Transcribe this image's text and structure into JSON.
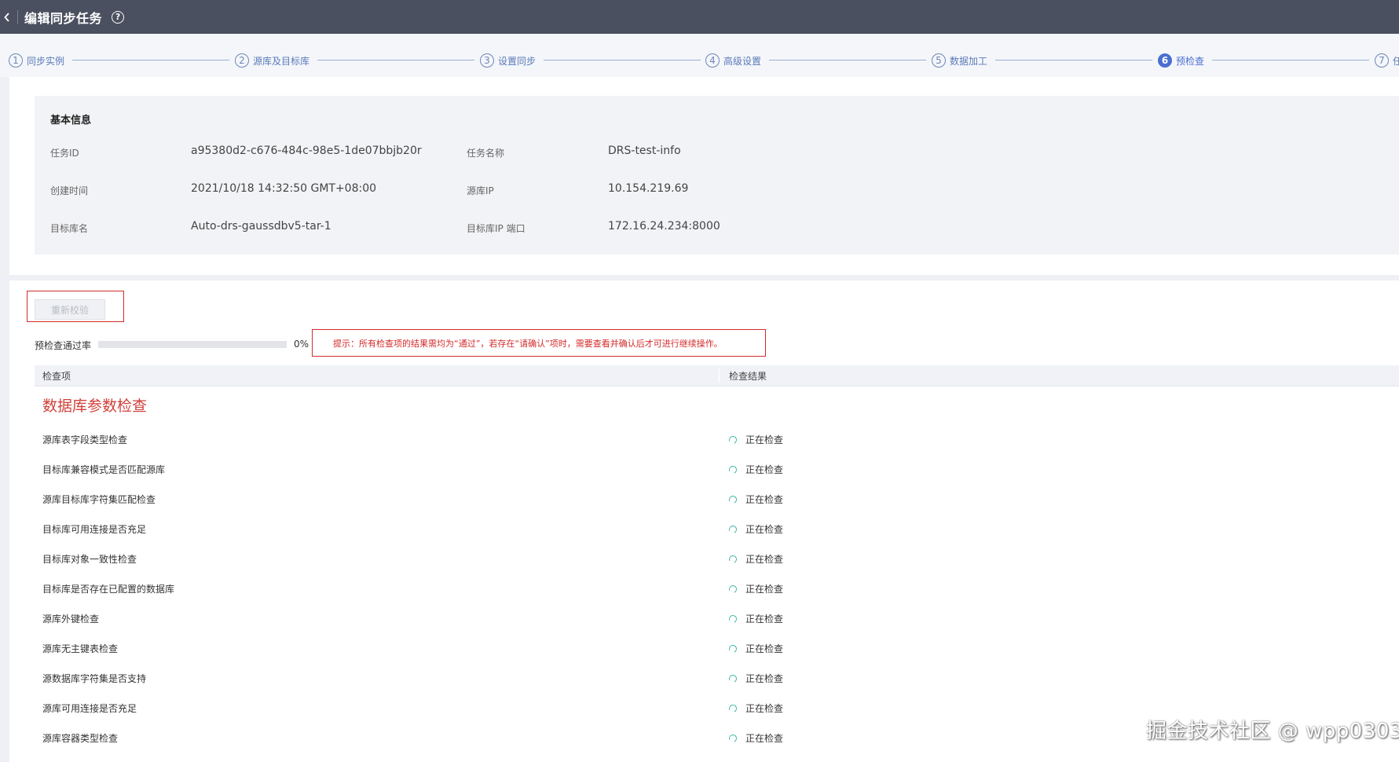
{
  "header": {
    "title": "编辑同步任务",
    "help_icon": "?"
  },
  "steps": [
    {
      "num": "1",
      "label": "同步实例"
    },
    {
      "num": "2",
      "label": "源库及目标库"
    },
    {
      "num": "3",
      "label": "设置同步"
    },
    {
      "num": "4",
      "label": "高级设置"
    },
    {
      "num": "5",
      "label": "数据加工"
    },
    {
      "num": "6",
      "label": "预检查",
      "active": true
    },
    {
      "num": "7",
      "label": "任"
    }
  ],
  "basic_info": {
    "title": "基本信息",
    "task_id_label": "任务ID",
    "task_id": "a95380d2-c676-484c-98e5-1de07bbjb20r",
    "task_name_label": "任务名称",
    "task_name": "DRS-test-info",
    "created_label": "创建时间",
    "created": "2021/10/18 14:32:50 GMT+08:00",
    "source_ip_label": "源库IP",
    "source_ip": "10.154.219.69",
    "target_db_label": "目标库名",
    "target_db": "Auto-drs-gaussdbv5-tar-1",
    "target_ip_label": "目标库IP 端口",
    "target_ip": "172.16.24.234:8000"
  },
  "precheck": {
    "recheck_label": "重新校验",
    "rate_label": "预检查通过率",
    "rate_value": "0%",
    "rate_fraction": 0,
    "hint": "提示：所有检查项的结果需均为“通过”，若存在“请确认”项时，需要查看并确认后才可进行继续操作。",
    "col_item": "检查项",
    "col_result": "检查结果",
    "section_title": "数据库参数检查",
    "rows": [
      {
        "item": "源库表字段类型检查",
        "status": "正在检查"
      },
      {
        "item": "目标库兼容模式是否匹配源库",
        "status": "正在检查"
      },
      {
        "item": "源库目标库字符集匹配检查",
        "status": "正在检查"
      },
      {
        "item": "目标库可用连接是否充足",
        "status": "正在检查"
      },
      {
        "item": "目标库对象一致性检查",
        "status": "正在检查"
      },
      {
        "item": "目标库是否存在已配置的数据库",
        "status": "正在检查"
      },
      {
        "item": "源库外键检查",
        "status": "正在检查"
      },
      {
        "item": "源库无主键表检查",
        "status": "正在检查"
      },
      {
        "item": "源数据库字符集是否支持",
        "status": "正在检查"
      },
      {
        "item": "源库可用连接是否充足",
        "status": "正在检查"
      },
      {
        "item": "源库容器类型检查",
        "status": "正在检查"
      }
    ]
  },
  "watermark": "掘金技术社区 @ wpp0303",
  "colors": {
    "topbar": "#4b5060",
    "accent": "#4a6fd0",
    "highlight_red": "#d32a2a",
    "spinner": "#3db8a4"
  }
}
